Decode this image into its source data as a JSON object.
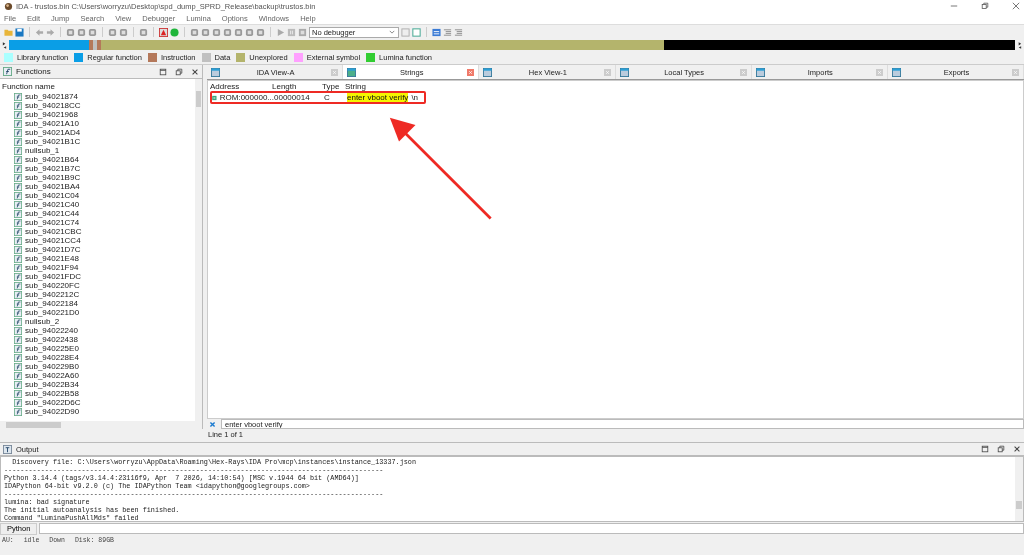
{
  "window": {
    "title": "IDA - trustos.bin C:\\Users\\worryzu\\Desktop\\spd_dump_SPRD_Release\\backup\\trustos.bin"
  },
  "menu": [
    "File",
    "Edit",
    "Jump",
    "Search",
    "View",
    "Debugger",
    "Lumina",
    "Options",
    "Windows",
    "Help"
  ],
  "toolbar": {
    "debugger": "No debugger"
  },
  "legend": [
    {
      "label": "Library function",
      "color": "#aaffff"
    },
    {
      "label": "Regular function",
      "color": "#0a9ee6"
    },
    {
      "label": "Instruction",
      "color": "#b4785a"
    },
    {
      "label": "Data",
      "color": "#c0c0c0"
    },
    {
      "label": "Unexplored",
      "color": "#b4b46c"
    },
    {
      "label": "External symbol",
      "color": "#ffa0ff"
    },
    {
      "label": "Lumina function",
      "color": "#32cd32"
    }
  ],
  "functions": {
    "title": "Functions",
    "column": "Function name",
    "items": [
      "sub_94021874",
      "sub_940218CC",
      "sub_94021968",
      "sub_94021A10",
      "sub_94021AD4",
      "sub_94021B1C",
      "nullsub_1",
      "sub_94021B64",
      "sub_94021B7C",
      "sub_94021B9C",
      "sub_94021BA4",
      "sub_94021C04",
      "sub_94021C40",
      "sub_94021C44",
      "sub_94021C74",
      "sub_94021CBC",
      "sub_94021CC4",
      "sub_94021D7C",
      "sub_94021E48",
      "sub_94021F94",
      "sub_94021FDC",
      "sub_940220FC",
      "sub_9402212C",
      "sub_94022184",
      "sub_940221D0",
      "nullsub_2",
      "sub_94022240",
      "sub_94022438",
      "sub_940225E0",
      "sub_940228E4",
      "sub_940229B0",
      "sub_94022A60",
      "sub_94022B34",
      "sub_94022B58",
      "sub_94022D6C",
      "sub_94022D90"
    ]
  },
  "tabs": [
    {
      "label": "IDA View-A",
      "selected": false
    },
    {
      "label": "Strings",
      "selected": true
    },
    {
      "label": "Hex View-1",
      "selected": false
    },
    {
      "label": "Local Types",
      "selected": false
    },
    {
      "label": "Imports",
      "selected": false
    },
    {
      "label": "Exports",
      "selected": false
    }
  ],
  "strings": {
    "columns": [
      "Address",
      "Length",
      "Type",
      "String"
    ],
    "rows": [
      {
        "address": "ROM:000000...",
        "length": "00000014",
        "type": "C",
        "string_match": "enter vboot verify",
        "string_rest": "\\n"
      }
    ],
    "annotations": {
      "frame": true,
      "arrow": true
    },
    "search": "enter vboot verify",
    "line_info": "Line 1 of 1"
  },
  "output": {
    "title": "Output",
    "lines": [
      "  Discovery file: C:\\Users\\worryzu\\AppData\\Roaming\\Hex-Rays\\IDA Pro\\mcp\\instances\\instance_13337.json",
      "---------------------------------------------------------------------------------------------",
      "Python 3.14.4 (tags/v3.14.4:23116f9, Apr  7 2026, 14:10:54) [MSC v.1944 64 bit (AMD64)]",
      "IDAPython 64-bit v9.2.0 (c) The IDAPython Team <idapython@googlegroups.com>",
      "---------------------------------------------------------------------------------------------",
      "lumina: bad signature",
      "The initial autoanalysis has been finished.",
      "Command \"LuminaPushAllMds\" failed"
    ],
    "language": "Python"
  },
  "status": [
    "AU:",
    "idle",
    "Down",
    "Disk: 89GB"
  ]
}
